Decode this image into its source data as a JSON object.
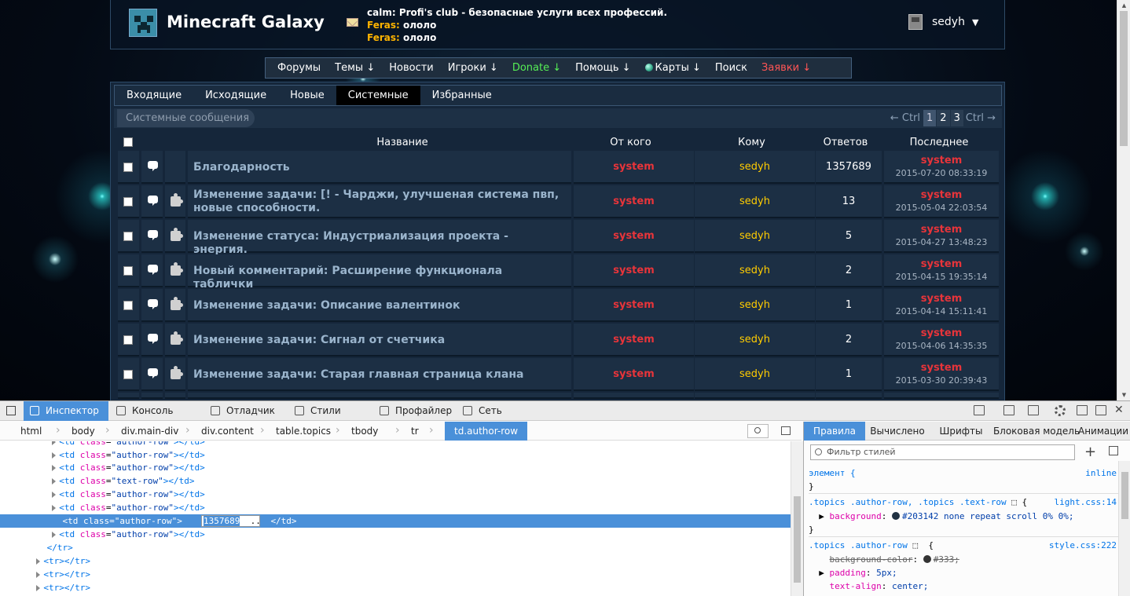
{
  "site": {
    "title": "Minecraft Galaxy"
  },
  "shoutbox": [
    {
      "nick": "calm:",
      "text": "Profi's club - безопасные услуги всех профессий.",
      "nick_color": "#ffffff"
    },
    {
      "nick": "Feras:",
      "text": "ололо",
      "nick_color": "#ffb400"
    },
    {
      "nick": "Feras:",
      "text": "ололо",
      "nick_color": "#ffb400"
    }
  ],
  "user": {
    "name": "sedyh",
    "caret": "▼"
  },
  "nav": [
    {
      "label": "Форумы",
      "color": "#ffffff"
    },
    {
      "label": "Темы ↓",
      "color": "#ffffff"
    },
    {
      "label": "Новости",
      "color": "#ffffff"
    },
    {
      "label": "Игроки ↓",
      "color": "#ffffff"
    },
    {
      "label": "Donate ↓",
      "color": "#55ee55"
    },
    {
      "label": "Помощь ↓",
      "color": "#ffffff"
    },
    {
      "label": "Карты ↓",
      "color": "#ffffff"
    },
    {
      "label": "Поиск",
      "color": "#ffffff"
    },
    {
      "label": "Заявки ↓",
      "color": "#ff5555"
    }
  ],
  "tabs": [
    {
      "label": "Входящие",
      "active": false
    },
    {
      "label": "Исходящие",
      "active": false
    },
    {
      "label": "Новые",
      "active": false
    },
    {
      "label": "Системные",
      "active": true
    },
    {
      "label": "Избранные",
      "active": false
    }
  ],
  "subbar": {
    "title": "Системные сообщения"
  },
  "pager": {
    "prev": "← Ctrl",
    "pages": [
      "1",
      "2",
      "3"
    ],
    "current": "1",
    "next": "Ctrl →"
  },
  "table": {
    "headers": {
      "title": "Название",
      "from": "От кого",
      "to": "Кому",
      "replies": "Ответов",
      "last": "Последнее"
    },
    "rows": [
      {
        "title": "Благодарность",
        "from": "system",
        "to": "sedyh",
        "replies": "1357689",
        "last_user": "system",
        "last_date": "2015-07-20 08:33:19",
        "puzzle": false
      },
      {
        "title": "Изменение задачи: [! - Чарджи, улучшеная система пвп, новые способности.",
        "from": "system",
        "to": "sedyh",
        "replies": "13",
        "last_user": "system",
        "last_date": "2015-05-04 22:03:54",
        "puzzle": true
      },
      {
        "title": "Изменение статуса: Индустриализация проекта - энергия.",
        "from": "system",
        "to": "sedyh",
        "replies": "5",
        "last_user": "system",
        "last_date": "2015-04-27 13:48:23",
        "puzzle": true
      },
      {
        "title": "Новый комментарий: Расширение функционала таблички",
        "from": "system",
        "to": "sedyh",
        "replies": "2",
        "last_user": "system",
        "last_date": "2015-04-15 19:35:14",
        "puzzle": true
      },
      {
        "title": "Изменение задачи: Описание валентинок",
        "from": "system",
        "to": "sedyh",
        "replies": "1",
        "last_user": "system",
        "last_date": "2015-04-14 15:11:41",
        "puzzle": true
      },
      {
        "title": "Изменение задачи: Сигнал от счетчика",
        "from": "system",
        "to": "sedyh",
        "replies": "2",
        "last_user": "system",
        "last_date": "2015-04-06 14:35:35",
        "puzzle": true
      },
      {
        "title": "Изменение задачи: Старая главная страница клана",
        "from": "system",
        "to": "sedyh",
        "replies": "1",
        "last_user": "system",
        "last_date": "2015-03-30 20:39:43",
        "puzzle": true
      }
    ]
  },
  "devtools": {
    "tabs": [
      "Инспектор",
      "Консоль",
      "Отладчик",
      "Стили",
      "Профайлер",
      "Сеть"
    ],
    "active_tab": "Инспектор",
    "breadcrumbs": [
      "html",
      "body",
      "div.main-div",
      "div.content",
      "table.topics",
      "tbody",
      "tr",
      "td.author-row"
    ],
    "markup": [
      {
        "indent": "      ",
        "text": "<td class=\"author-row\"></td>",
        "tag": "td",
        "cls": "author-row",
        "tri": true
      },
      {
        "indent": "      ",
        "text": "<td class=\"author-row\"></td>",
        "tag": "td",
        "cls": "author-row",
        "tri": true
      },
      {
        "indent": "      ",
        "text": "<td class=\"author-row\"></td>",
        "tag": "td",
        "cls": "author-row",
        "tri": true
      },
      {
        "indent": "      ",
        "text": "<td class=\"text-row\"></td>",
        "tag": "td",
        "cls": "text-row",
        "tri": true
      },
      {
        "indent": "      ",
        "text": "<td class=\"author-row\"></td>",
        "tag": "td",
        "cls": "author-row",
        "tri": true
      },
      {
        "indent": "      ",
        "text": "<td class=\"author-row\"></td>",
        "tag": "td",
        "cls": "author-row",
        "tri": true
      }
    ],
    "selected_value": "1357689",
    "side_tabs": [
      "Правила",
      "Вычислено",
      "Шрифты",
      "Блоковая модель",
      "Анимации"
    ],
    "filter_placeholder": "Фильтр стилей",
    "rules": {
      "element_sel": "элемент {",
      "element_src": "inline",
      "rule1_sel": ".topics .author-row, .topics .text-row",
      "rule1_src": "light.css:14",
      "rule1_prop": "background",
      "rule1_val": "#203142 none repeat scroll 0% 0%;",
      "rule2_sel": ".topics .author-row",
      "rule2_src": "style.css:222",
      "rule2_p1": "background-color",
      "rule2_v1": "#333;",
      "rule2_p2": "padding",
      "rule2_v2": "5px;",
      "rule2_p3": "text-align",
      "rule2_v3": "center;"
    }
  }
}
